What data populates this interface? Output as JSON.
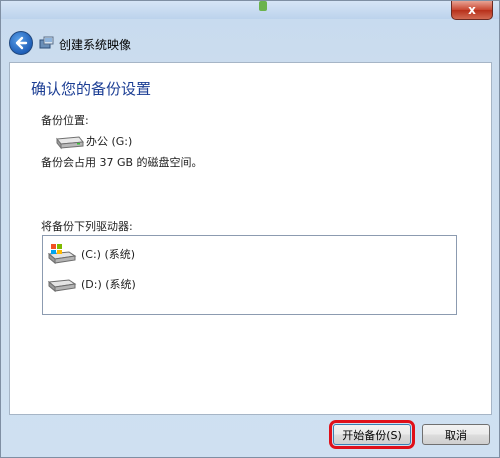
{
  "window": {
    "title": "创建系统映像",
    "close_glyph": "x"
  },
  "main": {
    "heading": "确认您的备份设置",
    "backup_location_label": "备份位置:",
    "backup_location_value": "办公 (G:)",
    "space_text": "备份会占用 37 GB 的磁盘空间。",
    "drives_label": "将备份下列驱动器:",
    "drives": [
      {
        "label": "(C:) (系统)",
        "icon": "windows-drive-icon"
      },
      {
        "label": "(D:) (系统)",
        "icon": "hard-drive-icon"
      }
    ]
  },
  "buttons": {
    "start_backup": "开始备份(S)",
    "cancel": "取消"
  },
  "colors": {
    "heading": "#1c3e94",
    "highlight": "#e0101a"
  }
}
